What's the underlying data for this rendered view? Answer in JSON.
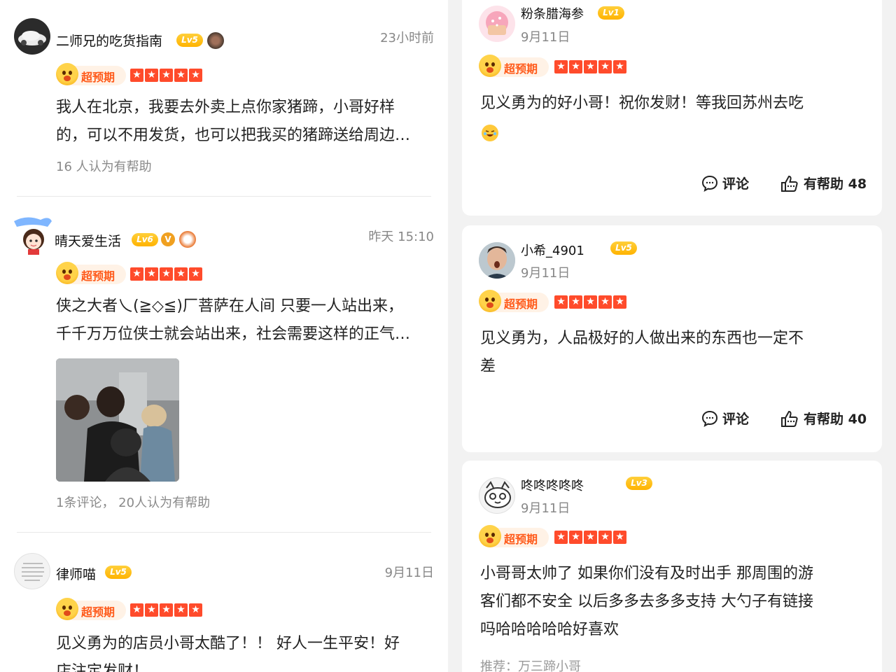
{
  "left_reviews": [
    {
      "username": "二师兄的吃货指南",
      "level": "Lv5",
      "time": "23小时前",
      "tag": "超预期",
      "stars": 5,
      "lines": [
        "我人在北京，我要去外卖上点你家猪蹄，小哥好样",
        "的，可以不用发货，也可以把我买的猪蹄送给周边…"
      ],
      "meta": "16 人认为有帮助"
    },
    {
      "username": "晴天爱生活",
      "level": "Lv6",
      "time": "昨天 15:10",
      "tag": "超预期",
      "stars": 5,
      "lines": [
        "侠之大者乀(≧◇≦)厂菩萨在人间 只要一人站出来，",
        "千千万万位侠士就会站出来，社会需要这样的正气…"
      ],
      "meta": "1条评论，  20人认为有帮助"
    },
    {
      "username": "律师喵",
      "level": "Lv5",
      "time": "9月11日",
      "tag": "超预期",
      "stars": 5,
      "lines": [
        "见义勇为的店员小哥太酷了！！ 好人一生平安！好",
        "店注定发财！"
      ]
    }
  ],
  "right_reviews": [
    {
      "username": "粉条腊海参",
      "level": "Lv1",
      "date": "9月11日",
      "tag": "超预期",
      "stars": 5,
      "lines": [
        "见义勇为的好小哥！祝你发财！等我回苏州去吃",
        ""
      ],
      "comment_label": "评论",
      "helpful_label": "有帮助 48"
    },
    {
      "username": "小希_4901",
      "level": "Lv5",
      "date": "9月11日",
      "tag": "超预期",
      "stars": 5,
      "lines": [
        "见义勇为，人品极好的人做出来的东西也一定不",
        "差"
      ],
      "comment_label": "评论",
      "helpful_label": "有帮助 40"
    },
    {
      "username": "咚咚咚咚咚",
      "level": "Lv3",
      "date": "9月11日",
      "tag": "超预期",
      "stars": 5,
      "lines": [
        "小哥哥太帅了 如果你们没有及时出手 那周围的游",
        "客们都不安全 以后多多去多多支持 大勺子有链接",
        "吗哈哈哈哈哈好喜欢"
      ],
      "recommend": "推荐：万三蹄小哥"
    }
  ],
  "icons": {
    "star": "★",
    "comment": "comment-icon",
    "helpful": "thumbs-up-icon",
    "verified": "V",
    "emoji": "laughing-crying-emoji"
  },
  "colors": {
    "accent": "#ff5a1a",
    "star": "#ff4b2b",
    "level": "#ffb300",
    "tag_bg": "#fff2e6"
  }
}
